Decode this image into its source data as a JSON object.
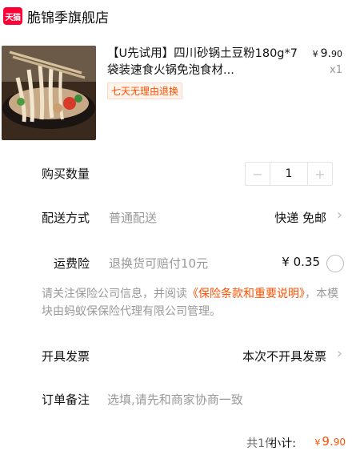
{
  "store": {
    "badge": "天猫",
    "name": "脆锦季旗舰店"
  },
  "product": {
    "title": "【U先试用】四川砂锅土豆粉180g*7袋装速食火锅免泡食材...",
    "price_symbol": "¥",
    "price_int": "9.",
    "price_dec": "90",
    "quantity": "x1",
    "return_tag": "七天无理由退换"
  },
  "buy_qty": {
    "label": "购买数量",
    "minus": "−",
    "value": "1",
    "plus": "+"
  },
  "delivery": {
    "label": "配送方式",
    "type": "普通配送",
    "value": "快递 免邮",
    "arrow": "›"
  },
  "shipping_insurance": {
    "label": "运费险",
    "desc": "退换货可赔付10元",
    "price": "¥ 0.35"
  },
  "notice": {
    "prefix": "请关注保险公司信息，并阅读",
    "link": "《保险条款和重要说明》",
    "suffix": "，本模块由蚂蚁保保险代理有限公司管理。"
  },
  "invoice": {
    "label": "开具发票",
    "value": "本次不开具发票",
    "arrow": "›"
  },
  "remark": {
    "label": "订单备注",
    "placeholder": "选填,请先和商家协商一致"
  },
  "footer": {
    "count": "共1件",
    "subtotal_label": "小计:",
    "symbol": "¥",
    "total_int": "9.",
    "total_dec": "90"
  },
  "colors": {
    "accent": "#ff5000",
    "tmall_red": "#ff0036",
    "muted": "#999999"
  }
}
